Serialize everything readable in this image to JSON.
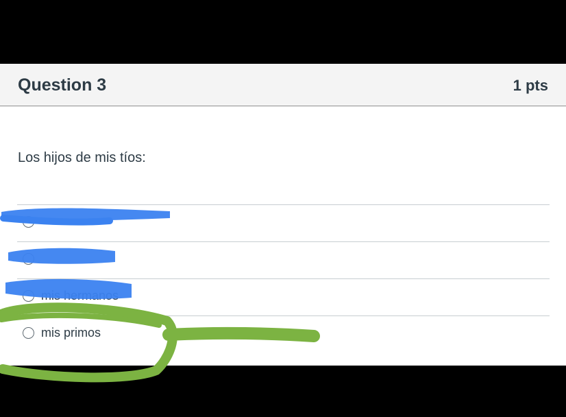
{
  "question": {
    "title": "Question 3",
    "points": "1 pts",
    "prompt": "Los hijos de mis tíos:"
  },
  "answers": [
    {
      "label": "",
      "selected": false,
      "redacted": true
    },
    {
      "label": "",
      "selected": false,
      "redacted": true
    },
    {
      "label": "mis hermanos",
      "selected": false,
      "redacted": true
    },
    {
      "label": "mis primos",
      "selected": false,
      "redacted": false
    }
  ],
  "annotations": {
    "redaction_color": "#3b82f0",
    "highlight_color": "#7cb342"
  },
  "colors": {
    "background": "#000000",
    "header_bg": "#f4f4f4",
    "text": "#2d3b45",
    "divider": "#c7cdd1"
  }
}
